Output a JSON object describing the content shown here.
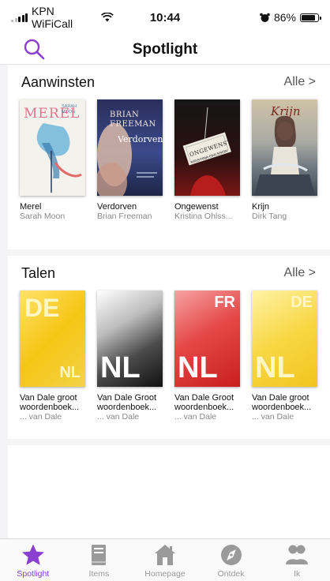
{
  "status": {
    "carrier": "KPN WiFiCall",
    "time": "10:44",
    "battery": "86%",
    "battery_level": 0.86
  },
  "header": {
    "title": "Spotlight"
  },
  "sections": [
    {
      "title": "Aanwinsten",
      "link": "Alle >",
      "books": [
        {
          "title": "Merel",
          "author": "Sarah Moon",
          "cover_text": "MEREL",
          "cover_sub": "SARAH MOON"
        },
        {
          "title": "Verdorven",
          "author": "Brian Freeman",
          "cover_text": "Verdorven",
          "cover_sub": "BRIAN FREEMAN"
        },
        {
          "title": "Ongewenst",
          "author": "Kristina Ohlss...",
          "cover_text": "ONGEWENST",
          "cover_sub": "KRISTINA OHLSSON"
        },
        {
          "title": "Krijn",
          "author": "Dirk Tang",
          "cover_text": "Krijn"
        }
      ]
    },
    {
      "title": "Talen",
      "link": "Alle >",
      "books": [
        {
          "title": "Van Dale groot woordenboek...",
          "author": "... van Dale",
          "top_code": "DE",
          "bottom_code": "NL"
        },
        {
          "title": "Van Dale Groot woordenboek...",
          "author": "... van Dale",
          "top_code": "",
          "bottom_code": "NL"
        },
        {
          "title": "Van Dale Groot woordenboek...",
          "author": "... van Dale",
          "top_code": "FR",
          "bottom_code": "NL"
        },
        {
          "title": "Van Dale groot woordenboek...",
          "author": "... van Dale",
          "top_code": "DE",
          "bottom_code": "NL"
        }
      ]
    }
  ],
  "tabs": [
    {
      "label": "Spotlight",
      "icon": "star-icon",
      "active": true
    },
    {
      "label": "Items",
      "icon": "book-icon",
      "active": false
    },
    {
      "label": "Homepage",
      "icon": "home-icon",
      "active": false
    },
    {
      "label": "Ontdek",
      "icon": "compass-icon",
      "active": false
    },
    {
      "label": "Ik",
      "icon": "people-icon",
      "active": false
    }
  ],
  "colors": {
    "accent": "#8a3fd1",
    "inactive": "#999999"
  }
}
